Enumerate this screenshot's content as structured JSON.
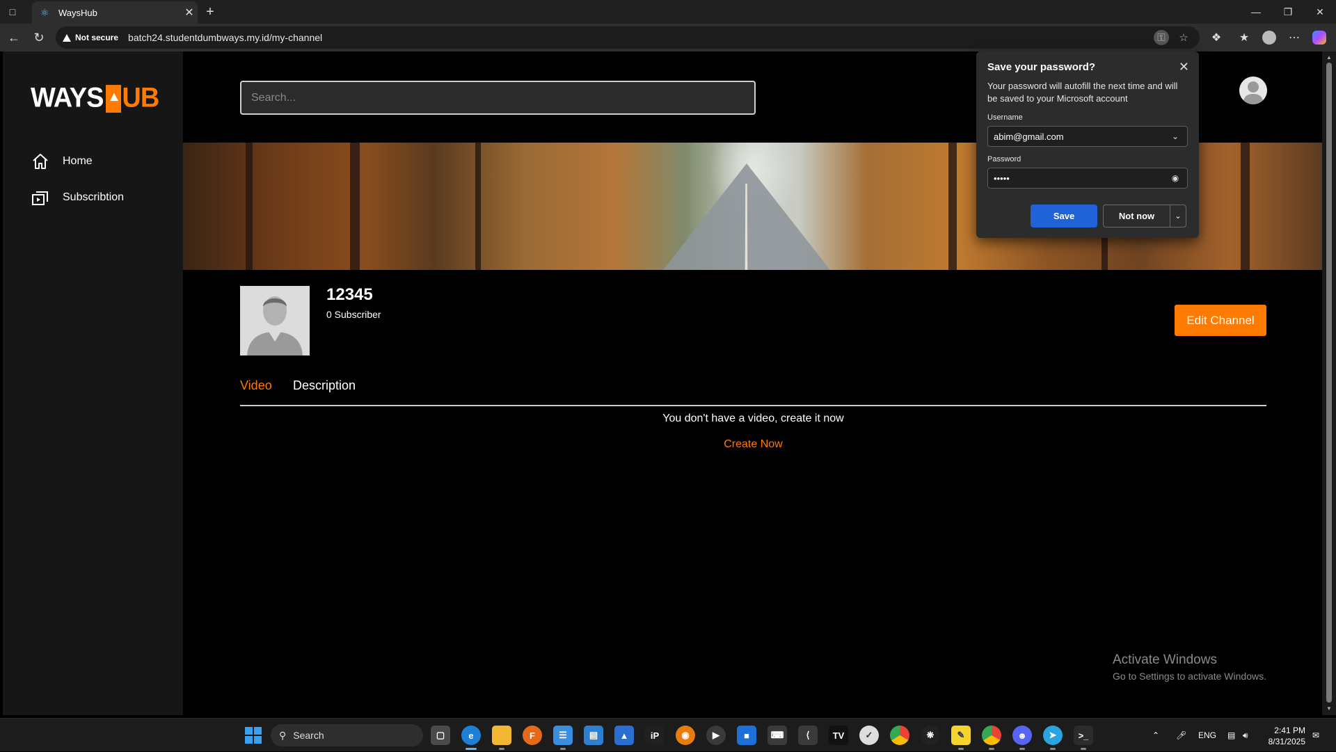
{
  "browser": {
    "tab_title": "WaysHub",
    "new_tab": "+",
    "security_label": "Not secure",
    "url": "batch24.studentdumbways.my.id/my-channel"
  },
  "sidebar": {
    "logo_left": "WAYS",
    "logo_right": "UB",
    "items": [
      {
        "label": "Home",
        "icon": "home-icon"
      },
      {
        "label": "Subscribtion",
        "icon": "subscription-icon"
      }
    ]
  },
  "header": {
    "search_placeholder": "Search..."
  },
  "channel": {
    "name": "12345",
    "subscribers": "0 Subscriber",
    "edit_label": "Edit Channel"
  },
  "tabs": [
    {
      "label": "Video",
      "active": true
    },
    {
      "label": "Description",
      "active": false
    }
  ],
  "empty_state": {
    "message": "You don't have a video, create it now",
    "action": "Create Now"
  },
  "password_prompt": {
    "title": "Save your password?",
    "description": "Your password will autofill the next time and will be saved to your Microsoft account",
    "username_label": "Username",
    "username_value": "abim@gmail.com",
    "password_label": "Password",
    "password_value": "•••••",
    "save_label": "Save",
    "not_now_label": "Not now"
  },
  "watermark": {
    "line1": "Activate Windows",
    "line2": "Go to Settings to activate Windows."
  },
  "taskbar": {
    "search_label": "Search",
    "language": "ENG",
    "time": "2:41 PM",
    "date": "8/31/2025"
  },
  "colors": {
    "accent": "#ff7a00",
    "save_button": "#1f63d6",
    "sidebar_bg": "#161616"
  }
}
